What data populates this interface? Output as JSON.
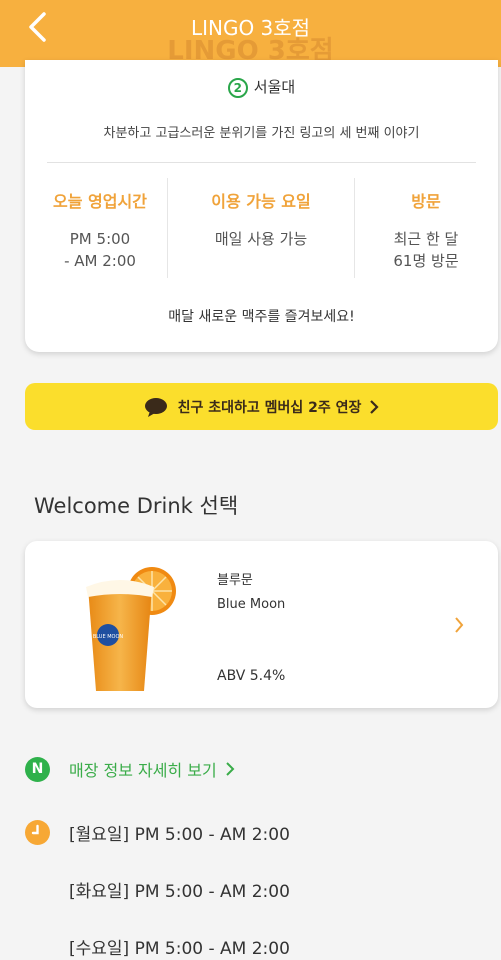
{
  "header": {
    "title": "LINGO 3호점",
    "ghost_title": "LINGO 3호점",
    "back_icon": "chevron-left-icon",
    "color": "#f7b03f"
  },
  "info": {
    "station_number": "2",
    "station_name": "서울대",
    "station_color": "#2aa64a",
    "description": "차분하고 고급스러운 분위기를 가진 링고의 세 번째 이야기",
    "columns": [
      {
        "heading": "오늘 영업시간",
        "value_line1": "PM 5:00",
        "value_line2": "- AM 2:00"
      },
      {
        "heading": "이용 가능 요일",
        "value_line1": "매일 사용 가능",
        "value_line2": ""
      },
      {
        "heading": "방문",
        "value_line1": "최근 한 달",
        "value_line2": "61명 방문"
      }
    ],
    "monthly_note": "매달 새로운 맥주를 즐겨보세요!"
  },
  "invite": {
    "label": "친구 초대하고 멤버십 2주 연장",
    "icon": "chat-bubble-icon",
    "color": "#fbde2c"
  },
  "welcome": {
    "section_title": "Welcome Drink 선택",
    "drink": {
      "name_kr": "블루문",
      "name_en": "Blue Moon",
      "abv": "ABV 5.4%",
      "image": "beer-glass-orange-icon",
      "logo_text": "BLUE MOON"
    }
  },
  "store_info": {
    "label": "매장 정보 자세히 보기",
    "icon": "naver-n-icon"
  },
  "hours": {
    "icon": "clock-icon",
    "rows": [
      "[월요일] PM 5:00 - AM 2:00",
      "[화요일] PM 5:00 - AM 2:00",
      "[수요일] PM 5:00 - AM 2:00"
    ]
  }
}
